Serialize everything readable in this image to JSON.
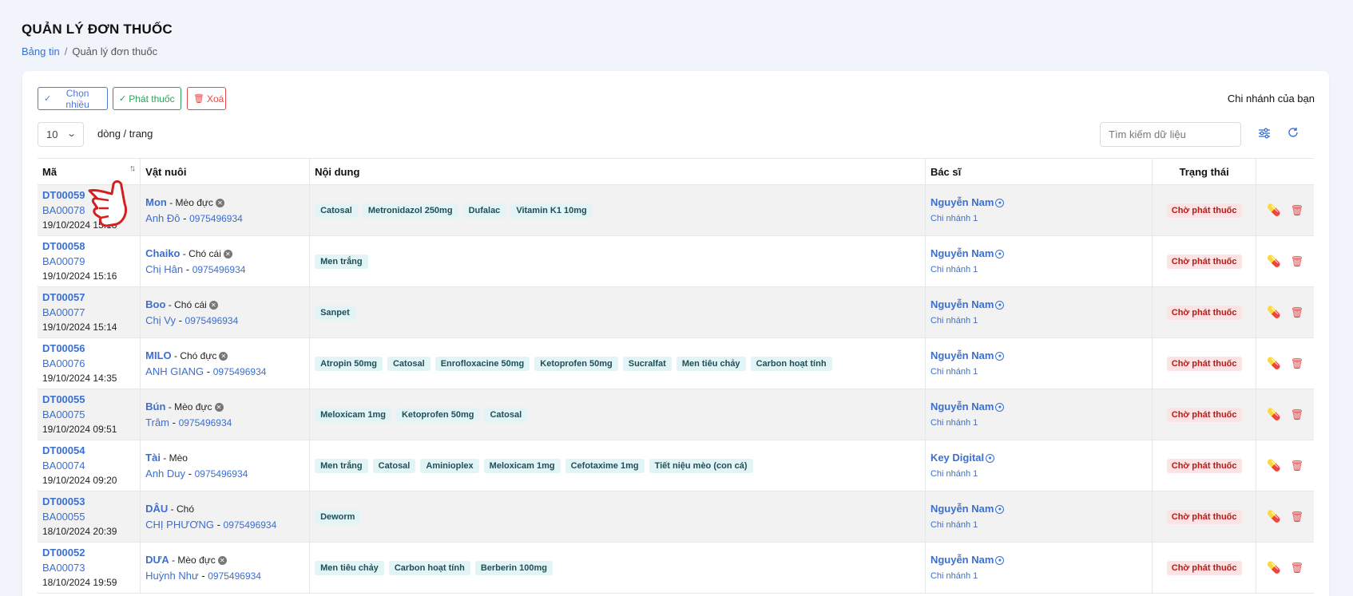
{
  "header": {
    "title": "QUẢN LÝ ĐƠN THUỐC",
    "breadcrumb_home": "Bảng tin",
    "breadcrumb_sep": "/",
    "breadcrumb_current": "Quản lý đơn thuốc"
  },
  "toolbar": {
    "multi_select_label": "Chọn nhiều",
    "dispense_label": "Phát thuốc",
    "delete_label": "Xoá",
    "branch_label": "Chi nhánh của bạn",
    "page_size_value": "10",
    "page_size_suffix": "dòng / trang",
    "search_placeholder": "Tìm kiếm dữ liệu",
    "settings_icon": "sliders-icon",
    "refresh_icon": "refresh-icon"
  },
  "table": {
    "columns": [
      "Mã",
      "Vật nuôi",
      "Nội dung",
      "Bác sĩ",
      "Trạng thái",
      ""
    ],
    "rows": [
      {
        "code": "DT00059",
        "record": "BA00078",
        "date": "19/10/2024 15:18",
        "pet": "Mon",
        "pet_info": "Mèo đực",
        "owner": "Anh Đô",
        "phone": "0975496934",
        "items": [
          "Catosal",
          "Metronidazol 250mg",
          "Dufalac",
          "Vitamin K1 10mg"
        ],
        "doctor": "Nguyễn Nam",
        "branch": "Chi nhánh 1",
        "status": "Chờ phát thuốc"
      },
      {
        "code": "DT00058",
        "record": "BA00079",
        "date": "19/10/2024 15:16",
        "pet": "Chaiko",
        "pet_info": "Chó cái",
        "owner": "Chị Hân",
        "phone": "0975496934",
        "items": [
          "Men trắng"
        ],
        "doctor": "Nguyễn Nam",
        "branch": "Chi nhánh 1",
        "status": "Chờ phát thuốc"
      },
      {
        "code": "DT00057",
        "record": "BA00077",
        "date": "19/10/2024 15:14",
        "pet": "Boo",
        "pet_info": "Chó cái",
        "owner": "Chị Vy",
        "phone": "0975496934",
        "items": [
          "Sanpet"
        ],
        "doctor": "Nguyễn Nam",
        "branch": "Chi nhánh 1",
        "status": "Chờ phát thuốc"
      },
      {
        "code": "DT00056",
        "record": "BA00076",
        "date": "19/10/2024 14:35",
        "pet": "MILO",
        "pet_info": "Chó đực",
        "owner": "ANH GIANG",
        "phone": "0975496934",
        "items": [
          "Atropin 50mg",
          "Catosal",
          "Enrofloxacine 50mg",
          "Ketoprofen 50mg",
          "Sucralfat",
          "Men tiêu chảy",
          "Carbon hoạt tính"
        ],
        "doctor": "Nguyễn Nam",
        "branch": "Chi nhánh 1",
        "status": "Chờ phát thuốc"
      },
      {
        "code": "DT00055",
        "record": "BA00075",
        "date": "19/10/2024 09:51",
        "pet": "Bún",
        "pet_info": "Mèo đực",
        "owner": "Trâm",
        "phone": "0975496934",
        "items": [
          "Meloxicam 1mg",
          "Ketoprofen 50mg",
          "Catosal"
        ],
        "doctor": "Nguyễn Nam",
        "branch": "Chi nhánh 1",
        "status": "Chờ phát thuốc"
      },
      {
        "code": "DT00054",
        "record": "BA00074",
        "date": "19/10/2024 09:20",
        "pet": "Tài",
        "pet_info": "Mèo",
        "owner": "Anh Duy",
        "phone": "0975496934",
        "items": [
          "Men trắng",
          "Catosal",
          "Aminioplex",
          "Meloxicam 1mg",
          "Cefotaxime 1mg",
          "Tiết niệu mèo (con cá)"
        ],
        "doctor": "Key Digital",
        "branch": "Chi nhánh 1",
        "status": "Chờ phát thuốc"
      },
      {
        "code": "DT00053",
        "record": "BA00055",
        "date": "18/10/2024 20:39",
        "pet": "DÂU",
        "pet_info": "Chó",
        "owner": "CHỊ PHƯƠNG",
        "phone": "0975496934",
        "items": [
          "Deworm"
        ],
        "doctor": "Nguyễn Nam",
        "branch": "Chi nhánh 1",
        "status": "Chờ phát thuốc"
      },
      {
        "code": "DT00052",
        "record": "BA00073",
        "date": "18/10/2024 19:59",
        "pet": "DƯA",
        "pet_info": "Mèo đực",
        "owner": "Huỳnh Như",
        "phone": "0975496934",
        "items": [
          "Men tiêu chảy",
          "Carbon hoạt tính",
          "Berberin 100mg"
        ],
        "doctor": "Nguyễn Nam",
        "branch": "Chi nhánh 1",
        "status": "Chờ phát thuốc"
      }
    ]
  },
  "colors": {
    "accent": "#3b6fd1",
    "success": "#2e9d5b",
    "danger": "#e04a4a",
    "tag_bg": "#e3f4f6",
    "status_bg": "#fde3e3"
  }
}
